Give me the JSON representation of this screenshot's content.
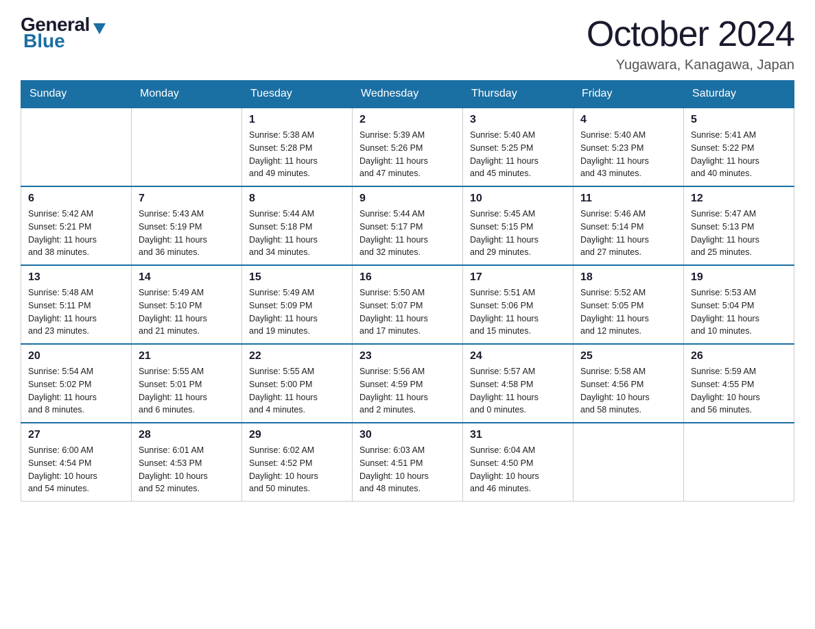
{
  "header": {
    "logo": {
      "general": "General",
      "blue": "Blue"
    },
    "title": "October 2024",
    "location": "Yugawara, Kanagawa, Japan"
  },
  "calendar": {
    "days_of_week": [
      "Sunday",
      "Monday",
      "Tuesday",
      "Wednesday",
      "Thursday",
      "Friday",
      "Saturday"
    ],
    "weeks": [
      [
        {
          "day": "",
          "info": ""
        },
        {
          "day": "",
          "info": ""
        },
        {
          "day": "1",
          "info": "Sunrise: 5:38 AM\nSunset: 5:28 PM\nDaylight: 11 hours\nand 49 minutes."
        },
        {
          "day": "2",
          "info": "Sunrise: 5:39 AM\nSunset: 5:26 PM\nDaylight: 11 hours\nand 47 minutes."
        },
        {
          "day": "3",
          "info": "Sunrise: 5:40 AM\nSunset: 5:25 PM\nDaylight: 11 hours\nand 45 minutes."
        },
        {
          "day": "4",
          "info": "Sunrise: 5:40 AM\nSunset: 5:23 PM\nDaylight: 11 hours\nand 43 minutes."
        },
        {
          "day": "5",
          "info": "Sunrise: 5:41 AM\nSunset: 5:22 PM\nDaylight: 11 hours\nand 40 minutes."
        }
      ],
      [
        {
          "day": "6",
          "info": "Sunrise: 5:42 AM\nSunset: 5:21 PM\nDaylight: 11 hours\nand 38 minutes."
        },
        {
          "day": "7",
          "info": "Sunrise: 5:43 AM\nSunset: 5:19 PM\nDaylight: 11 hours\nand 36 minutes."
        },
        {
          "day": "8",
          "info": "Sunrise: 5:44 AM\nSunset: 5:18 PM\nDaylight: 11 hours\nand 34 minutes."
        },
        {
          "day": "9",
          "info": "Sunrise: 5:44 AM\nSunset: 5:17 PM\nDaylight: 11 hours\nand 32 minutes."
        },
        {
          "day": "10",
          "info": "Sunrise: 5:45 AM\nSunset: 5:15 PM\nDaylight: 11 hours\nand 29 minutes."
        },
        {
          "day": "11",
          "info": "Sunrise: 5:46 AM\nSunset: 5:14 PM\nDaylight: 11 hours\nand 27 minutes."
        },
        {
          "day": "12",
          "info": "Sunrise: 5:47 AM\nSunset: 5:13 PM\nDaylight: 11 hours\nand 25 minutes."
        }
      ],
      [
        {
          "day": "13",
          "info": "Sunrise: 5:48 AM\nSunset: 5:11 PM\nDaylight: 11 hours\nand 23 minutes."
        },
        {
          "day": "14",
          "info": "Sunrise: 5:49 AM\nSunset: 5:10 PM\nDaylight: 11 hours\nand 21 minutes."
        },
        {
          "day": "15",
          "info": "Sunrise: 5:49 AM\nSunset: 5:09 PM\nDaylight: 11 hours\nand 19 minutes."
        },
        {
          "day": "16",
          "info": "Sunrise: 5:50 AM\nSunset: 5:07 PM\nDaylight: 11 hours\nand 17 minutes."
        },
        {
          "day": "17",
          "info": "Sunrise: 5:51 AM\nSunset: 5:06 PM\nDaylight: 11 hours\nand 15 minutes."
        },
        {
          "day": "18",
          "info": "Sunrise: 5:52 AM\nSunset: 5:05 PM\nDaylight: 11 hours\nand 12 minutes."
        },
        {
          "day": "19",
          "info": "Sunrise: 5:53 AM\nSunset: 5:04 PM\nDaylight: 11 hours\nand 10 minutes."
        }
      ],
      [
        {
          "day": "20",
          "info": "Sunrise: 5:54 AM\nSunset: 5:02 PM\nDaylight: 11 hours\nand 8 minutes."
        },
        {
          "day": "21",
          "info": "Sunrise: 5:55 AM\nSunset: 5:01 PM\nDaylight: 11 hours\nand 6 minutes."
        },
        {
          "day": "22",
          "info": "Sunrise: 5:55 AM\nSunset: 5:00 PM\nDaylight: 11 hours\nand 4 minutes."
        },
        {
          "day": "23",
          "info": "Sunrise: 5:56 AM\nSunset: 4:59 PM\nDaylight: 11 hours\nand 2 minutes."
        },
        {
          "day": "24",
          "info": "Sunrise: 5:57 AM\nSunset: 4:58 PM\nDaylight: 11 hours\nand 0 minutes."
        },
        {
          "day": "25",
          "info": "Sunrise: 5:58 AM\nSunset: 4:56 PM\nDaylight: 10 hours\nand 58 minutes."
        },
        {
          "day": "26",
          "info": "Sunrise: 5:59 AM\nSunset: 4:55 PM\nDaylight: 10 hours\nand 56 minutes."
        }
      ],
      [
        {
          "day": "27",
          "info": "Sunrise: 6:00 AM\nSunset: 4:54 PM\nDaylight: 10 hours\nand 54 minutes."
        },
        {
          "day": "28",
          "info": "Sunrise: 6:01 AM\nSunset: 4:53 PM\nDaylight: 10 hours\nand 52 minutes."
        },
        {
          "day": "29",
          "info": "Sunrise: 6:02 AM\nSunset: 4:52 PM\nDaylight: 10 hours\nand 50 minutes."
        },
        {
          "day": "30",
          "info": "Sunrise: 6:03 AM\nSunset: 4:51 PM\nDaylight: 10 hours\nand 48 minutes."
        },
        {
          "day": "31",
          "info": "Sunrise: 6:04 AM\nSunset: 4:50 PM\nDaylight: 10 hours\nand 46 minutes."
        },
        {
          "day": "",
          "info": ""
        },
        {
          "day": "",
          "info": ""
        }
      ]
    ]
  }
}
